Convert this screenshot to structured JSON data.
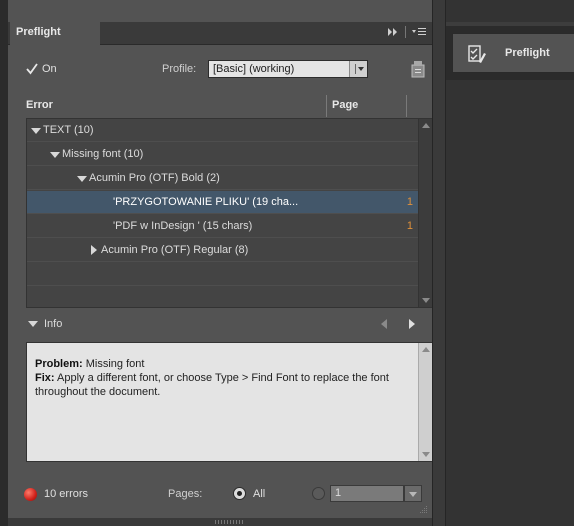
{
  "panel": {
    "tab_label": "Preflight",
    "on_label": "On",
    "profile_label": "Profile:",
    "profile_value": "[Basic] (working)"
  },
  "columns": {
    "error": "Error",
    "page": "Page"
  },
  "tree": [
    {
      "label": "TEXT (10)",
      "expanded": true,
      "page": ""
    },
    {
      "label": "Missing font (10)",
      "expanded": true,
      "page": ""
    },
    {
      "label": "Acumin Pro (OTF) Bold (2)",
      "expanded": true,
      "page": ""
    },
    {
      "label": "'PRZYGOTOWANIE PLIKU' (19 cha...",
      "page": "1",
      "selected": true
    },
    {
      "label": "'PDF w InDesign ' (15 chars)",
      "page": "1"
    },
    {
      "label": "Acumin Pro (OTF) Regular (8)",
      "expanded": false,
      "page": ""
    }
  ],
  "info": {
    "label": "Info",
    "problem_label": "Problem:",
    "problem_text": "Missing font",
    "fix_label": "Fix:",
    "fix_text": "Apply a different font, or choose Type > Find Font to replace the font throughout the document."
  },
  "status": {
    "error_count": "10 errors",
    "pages_label": "Pages:",
    "all_label": "All",
    "range_value": "1"
  },
  "side": {
    "button_label": "Preflight"
  },
  "colors": {
    "panel_bg": "#535353",
    "selection": "#43576a",
    "page_number": "#e0913a",
    "error_dot": "#d0201a"
  }
}
